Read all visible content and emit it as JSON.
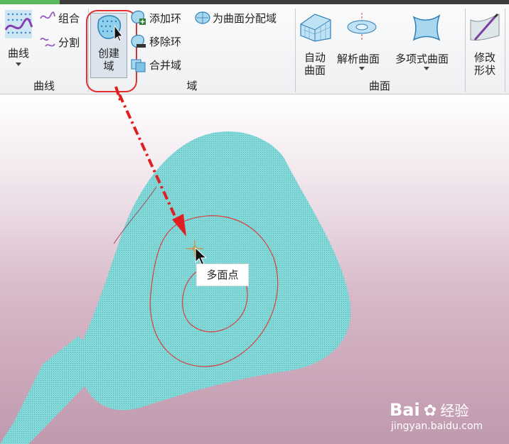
{
  "ribbon": {
    "curve_group": {
      "curve_button": "曲线",
      "combine": "组合",
      "split": "分割",
      "label": "曲线"
    },
    "domain_group": {
      "create_domain_line1": "创建",
      "create_domain_line2": "域",
      "add_loop": "添加环",
      "remove_loop": "移除环",
      "merge_domain": "合并域",
      "assign_to_surface": "为曲面分配域",
      "label": "域"
    },
    "surface_group": {
      "auto_surface_line1": "自动",
      "auto_surface_line2": "曲面",
      "analytic_surface": "解析曲面",
      "polynomial_surface": "多项式曲面",
      "label": "曲面"
    },
    "modify_group": {
      "modify_shape_line1": "修改",
      "modify_shape_line2": "形状"
    }
  },
  "viewport": {
    "tooltip": "多面点"
  },
  "watermark": {
    "brand": "Bai",
    "brand_cn": "经验",
    "url": "jingyan.baidu.com"
  },
  "colors": {
    "mesh": "#7fd6d6",
    "annotation_red": "#e02020",
    "ribbon_bg": "#f4f5f7"
  }
}
